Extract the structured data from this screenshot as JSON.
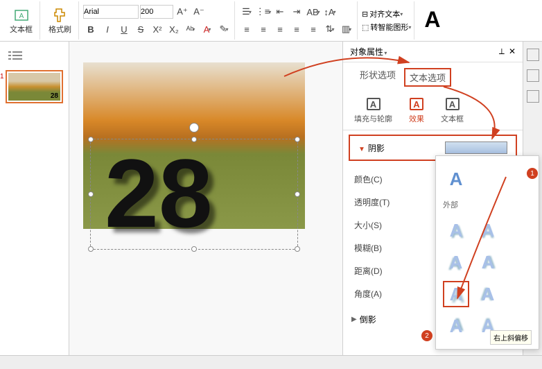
{
  "ribbon": {
    "textbox_label": "文本框",
    "format_painter_label": "格式刷",
    "font_name": "Arial",
    "font_size": "200",
    "increase_font": "A⁺",
    "decrease_font": "A⁻",
    "bold": "B",
    "italic": "I",
    "underline": "U",
    "strike": "S",
    "superscript": "X²",
    "subscript": "X₂",
    "align_text_label": "对齐文本",
    "convert_smartart_label": "转智能图形",
    "big_a": "A"
  },
  "thumb": {
    "num": "1",
    "text": "28"
  },
  "slide": {
    "text": "28"
  },
  "panel": {
    "title": "对象属性",
    "tab_shape": "形状选项",
    "tab_text": "文本选项",
    "subtab_fill": "填充与轮廓",
    "subtab_effect": "效果",
    "subtab_textbox": "文本框",
    "section_shadow": "阴影",
    "prop_color": "颜色(C)",
    "prop_opacity": "透明度(T)",
    "prop_size": "大小(S)",
    "prop_blur": "模糊(B)",
    "prop_distance": "距离(D)",
    "prop_angle": "角度(A)",
    "section_reflection": "倒影",
    "gallery_outer": "外部",
    "tooltip": "右上斜偏移"
  },
  "badges": {
    "one": "1",
    "two": "2"
  }
}
